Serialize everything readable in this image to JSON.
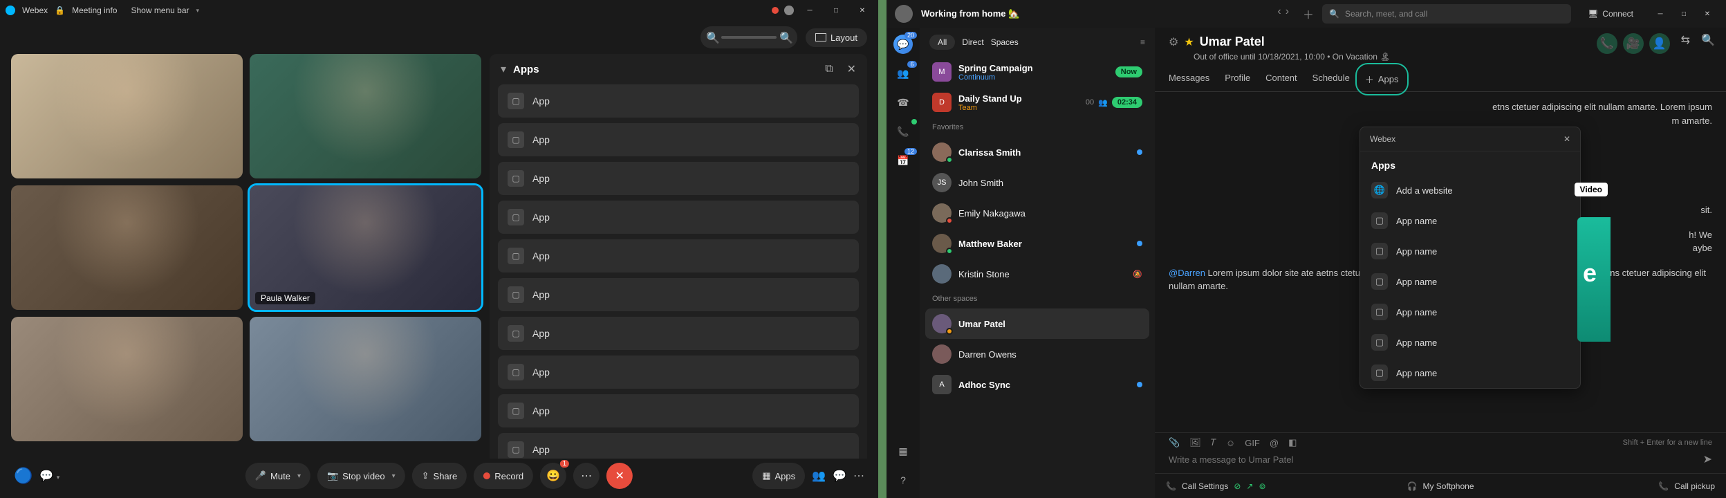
{
  "left": {
    "titlebar": {
      "app": "Webex",
      "meeting_info": "Meeting info",
      "menu": "Show menu bar"
    },
    "top": {
      "layout": "Layout"
    },
    "grid": {
      "speaker": "Paula Walker"
    },
    "apps": {
      "title": "Apps",
      "items": [
        "App",
        "App",
        "App",
        "App",
        "App",
        "App",
        "App",
        "App",
        "App",
        "App"
      ]
    },
    "controls": {
      "reactions_badge": "1",
      "mute": "Mute",
      "stop_video": "Stop video",
      "share": "Share",
      "record": "Record",
      "apps": "Apps"
    }
  },
  "right": {
    "status": "Working from home 🏡",
    "search_placeholder": "Search, meet, and call",
    "connect": "Connect",
    "rail": {
      "chat_badge": "20",
      "teams_badge": "6",
      "cal_badge": "12"
    },
    "filters": {
      "all": "All",
      "direct": "Direct",
      "spaces": "Spaces"
    },
    "sections": {
      "spring": {
        "name": "Spring Campaign",
        "sub": "Continuum",
        "now": "Now",
        "initial": "M"
      },
      "daily": {
        "name": "Daily Stand Up",
        "sub": "Team",
        "count": "00",
        "time": "02:34",
        "initial": "D"
      },
      "favorites": "Favorites",
      "other": "Other spaces",
      "people": {
        "clarissa": "Clarissa Smith",
        "john": "John Smith",
        "john_initials": "JS",
        "emily": "Emily Nakagawa",
        "matthew": "Matthew Baker",
        "kristin": "Kristin Stone",
        "umar": "Umar Patel",
        "darren": "Darren Owens",
        "adhoc": "Adhoc Sync",
        "adhoc_initial": "A"
      }
    },
    "convo": {
      "name": "Umar Patel",
      "status": "Out of office until 10/18/2021, 10:00  •  On Vacation 🏝",
      "tabs": {
        "messages": "Messages",
        "profile": "Profile",
        "content": "Content",
        "schedule": "Schedule",
        "apps": "Apps"
      },
      "msg1_a": "etns ctetuer adipiscing elit nullam amarte. Lorem ipsum",
      "msg1_b": "m amarte.",
      "msg2": "sit.",
      "msg3_a": "h! We",
      "msg3_b": "aybe",
      "msg4_mention": "@Darren",
      "msg4": " Lorem ipsum dolor site ate aetns ctetuer adipiscing elit nullam amarte. Lorem ipsum dolor site ate aetns ctetuer adipiscing elit nullam amarte.",
      "compose_placeholder": "Write a message to Umar Patel",
      "hint": "Shift + Enter for a new line",
      "video_chip": "Video"
    },
    "popover": {
      "hdr": "Webex",
      "title": "Apps",
      "add_site": "Add a website",
      "items": [
        "App name",
        "App name",
        "App name",
        "App name",
        "App name",
        "App name"
      ]
    },
    "footer": {
      "call_settings": "Call Settings",
      "softphone": "My Softphone",
      "pickup": "Call pickup"
    }
  }
}
